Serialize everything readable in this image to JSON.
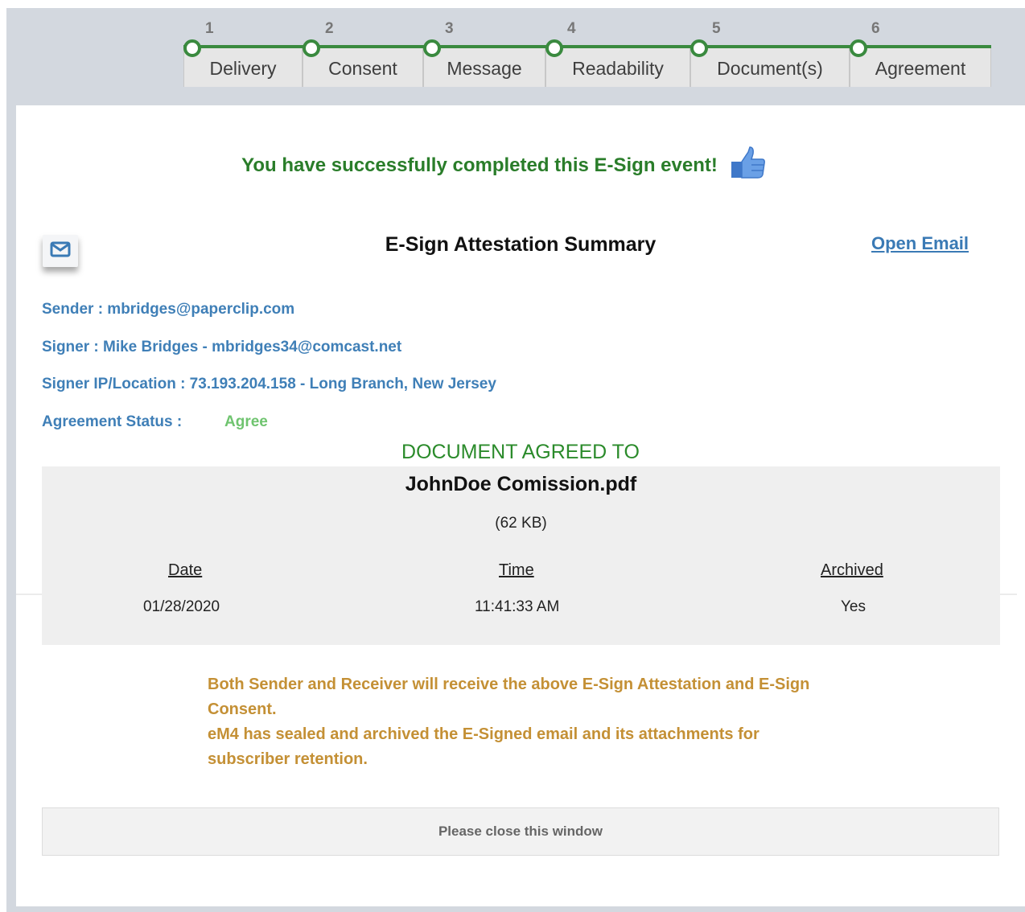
{
  "stepper": {
    "steps": [
      {
        "num": "1",
        "label": "Delivery"
      },
      {
        "num": "2",
        "label": "Consent"
      },
      {
        "num": "3",
        "label": "Message"
      },
      {
        "num": "4",
        "label": "Readability"
      },
      {
        "num": "5",
        "label": "Document(s)"
      },
      {
        "num": "6",
        "label": "Agreement"
      }
    ],
    "accent": "#3a8a3f"
  },
  "success_message": "You have successfully completed this E-Sign event!",
  "summary": {
    "title": "E-Sign Attestation Summary",
    "open_email": "Open Email",
    "sender": "Sender : mbridges@paperclip.com",
    "signer": "Signer : Mike Bridges - mbridges34@comcast.net",
    "signer_ip": "Signer IP/Location : 73.193.204.158 - Long Branch, New Jersey",
    "status_label": "Agreement Status :",
    "status_value": "Agree"
  },
  "document": {
    "heading": "DOCUMENT AGREED TO",
    "file_name": "JohnDoe Comission.pdf",
    "file_size": "(62 KB)",
    "columns": [
      "Date",
      "Time",
      "Archived"
    ],
    "values": [
      "01/28/2020",
      "11:41:33 AM",
      "Yes"
    ]
  },
  "notice": {
    "line1": "Both Sender and Receiver will receive the above E-Sign Attestation and E-Sign Consent.",
    "line2": "eM4 has sealed and archived the E-Signed email and its attachments for subscriber retention."
  },
  "close_label": "Please close this window",
  "colors": {
    "success_green": "#2a7d2a",
    "info_blue": "#3f7fb7",
    "notice_gold": "#c49035"
  }
}
